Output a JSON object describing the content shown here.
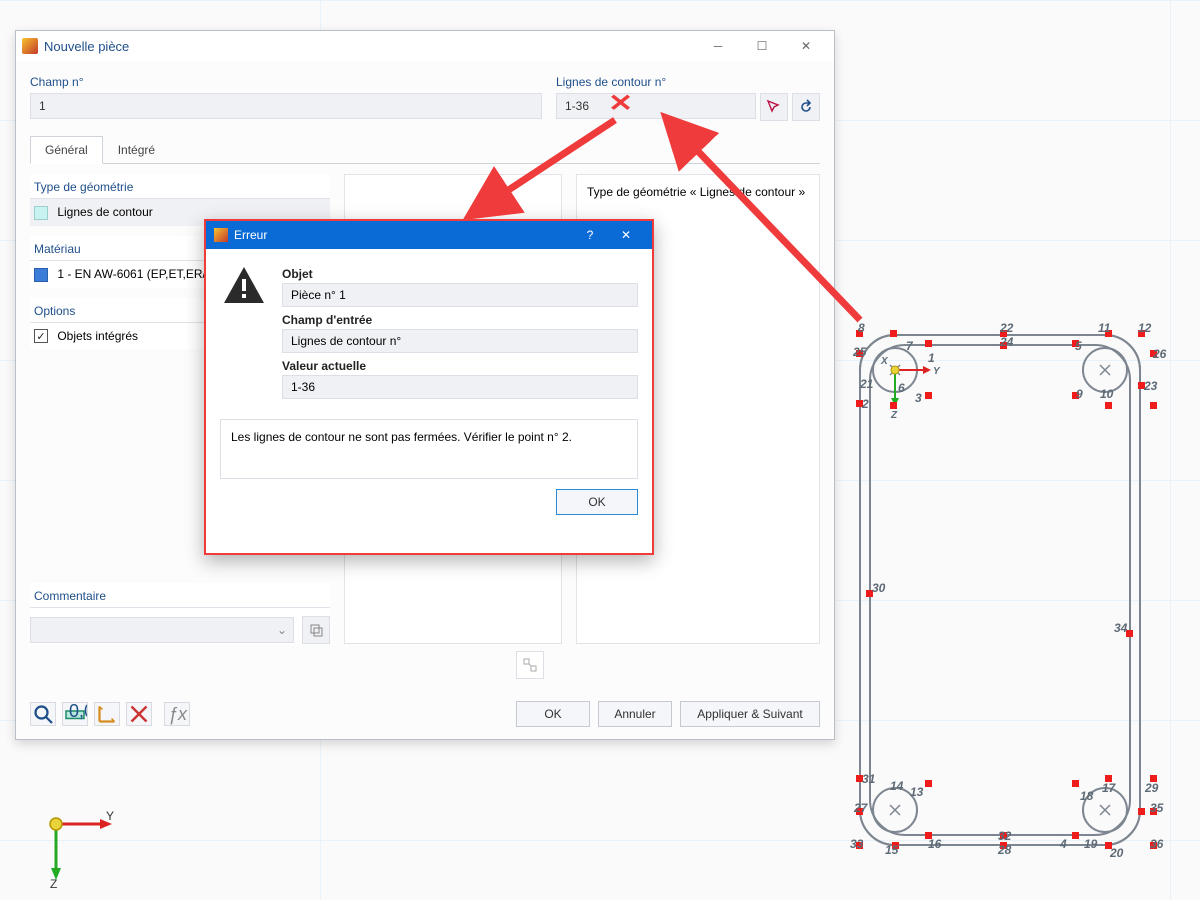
{
  "dialog": {
    "title": "Nouvelle pièce",
    "field_no_label": "Champ n°",
    "field_no_value": "1",
    "contour_label": "Lignes de contour n°",
    "contour_value": "1-36",
    "tabs": {
      "general": "Général",
      "integre": "Intégré"
    },
    "geom_type_hdr": "Type de géométrie",
    "geom_type_val": "Lignes de contour",
    "material_hdr": "Matériau",
    "material_val": "1 - EN AW-6061 (EP,ET,ER/B)",
    "options_hdr": "Options",
    "options_chk": "Objets intégrés",
    "right_summary": "Type de géométrie « Lignes de contour »",
    "comment_hdr": "Commentaire",
    "footer": {
      "ok": "OK",
      "cancel": "Annuler",
      "apply_next": "Appliquer & Suivant"
    }
  },
  "error": {
    "title": "Erreur",
    "obj_lbl": "Objet",
    "obj_val": "Pièce n° 1",
    "field_lbl": "Champ d'entrée",
    "field_val": "Lignes de contour n°",
    "value_lbl": "Valeur actuelle",
    "value_val": "1-36",
    "message": "Les lignes de contour ne sont pas fermées. Vérifier le point n° 2.",
    "ok": "OK"
  },
  "axes": {
    "y": "Y",
    "z": "Z",
    "x": "X"
  },
  "geo_labels": [
    "1",
    "2",
    "3",
    "4",
    "5",
    "6",
    "7",
    "8",
    "9",
    "10",
    "11",
    "12",
    "13",
    "14",
    "15",
    "16",
    "17",
    "18",
    "19",
    "20",
    "21",
    "22",
    "23",
    "24",
    "25",
    "26",
    "27",
    "28",
    "29",
    "30",
    "31",
    "32",
    "33",
    "34",
    "35",
    "36"
  ]
}
